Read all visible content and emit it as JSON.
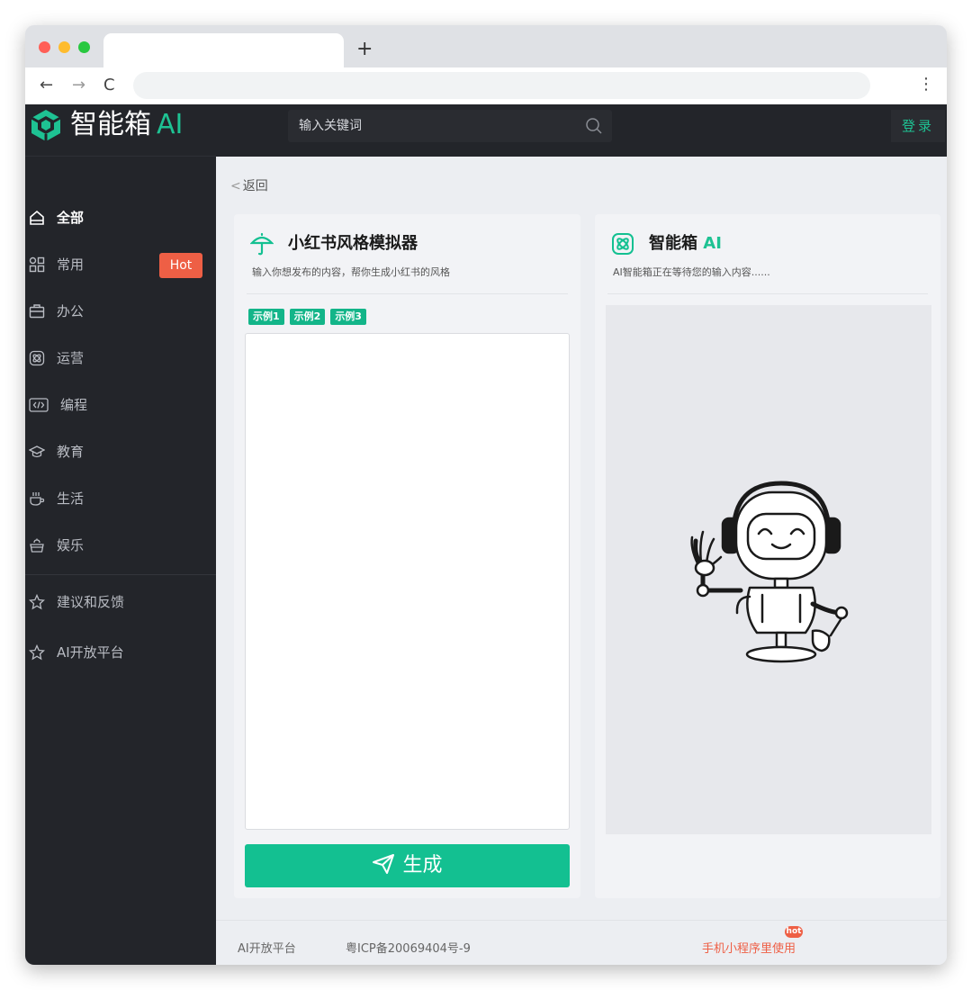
{
  "browser": {
    "new_tab": "+",
    "back": "←",
    "forward": "→",
    "reload": "C",
    "menu": "⋮"
  },
  "logo": {
    "text": "智能箱",
    "ai": "AI"
  },
  "sidebar": {
    "items": [
      {
        "label": "全部",
        "icon": "home-icon"
      },
      {
        "label": "常用",
        "icon": "grid-icon",
        "badge": "Hot"
      },
      {
        "label": "办公",
        "icon": "briefcase-icon"
      },
      {
        "label": "运营",
        "icon": "atom-icon"
      },
      {
        "label": "编程",
        "icon": "code-icon"
      },
      {
        "label": "教育",
        "icon": "graduation-cap-icon"
      },
      {
        "label": "生活",
        "icon": "coffee-cup-icon"
      },
      {
        "label": "娱乐",
        "icon": "bucket-icon"
      }
    ],
    "bottom_items": [
      {
        "label": "建议和反馈",
        "icon": "star-icon"
      },
      {
        "label": "AI开放平台",
        "icon": "star-icon"
      }
    ]
  },
  "header": {
    "search_placeholder": "输入关键词",
    "login_label": "登录"
  },
  "main": {
    "back_chevron": "<",
    "back_label": "返回"
  },
  "tool": {
    "title": "小红书风格模拟器",
    "description": "输入你想发布的内容，帮你生成小红书的风格",
    "examples": [
      "示例1",
      "示例2",
      "示例3"
    ],
    "input_value": "",
    "generate_label": "生成"
  },
  "output": {
    "title": "智能箱",
    "title_ai": "AI",
    "description": "AI智能箱正在等待您的输入内容......"
  },
  "footer": {
    "platform": "AI开放平台",
    "icp": "粤ICP备20069404号-9",
    "mini_program": "手机小程序里使用",
    "hot": "hot"
  },
  "colors": {
    "accent": "#13c091",
    "hot": "#ee5f45",
    "sidebar_bg": "#23252a"
  }
}
